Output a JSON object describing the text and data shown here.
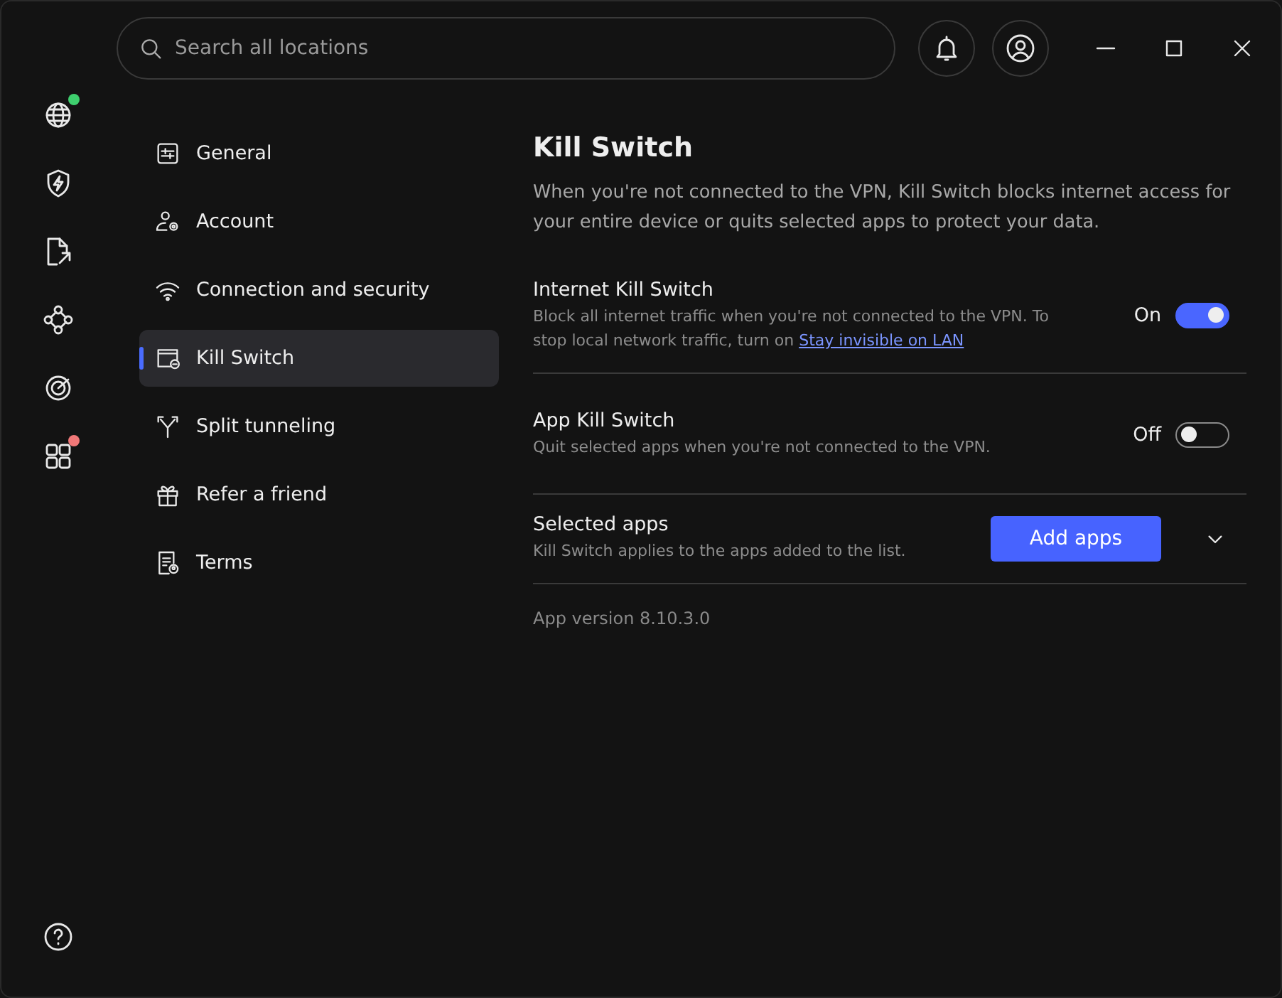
{
  "search": {
    "placeholder": "Search all locations"
  },
  "rail": [
    {
      "kind": "globe",
      "color": "#3ecf6e"
    },
    {
      "kind": "shield"
    },
    {
      "kind": "file"
    },
    {
      "kind": "nodes"
    },
    {
      "kind": "target"
    },
    {
      "kind": "apps",
      "color": "#f07878"
    }
  ],
  "menu": [
    {
      "kind": "sliders",
      "label": "General",
      "selected": false
    },
    {
      "kind": "account",
      "label": "Account",
      "selected": false
    },
    {
      "kind": "wifi",
      "label": "Connection and security",
      "selected": false
    },
    {
      "kind": "killswitch",
      "label": "Kill Switch",
      "selected": true
    },
    {
      "kind": "split",
      "label": "Split tunneling",
      "selected": false
    },
    {
      "kind": "gift",
      "label": "Refer a friend",
      "selected": false
    },
    {
      "kind": "terms",
      "label": "Terms",
      "selected": false
    }
  ],
  "page": {
    "title": "Kill Switch",
    "description": "When you're not connected to the VPN, Kill Switch blocks internet access for your entire device or quits selected apps to protect your data."
  },
  "settings": [
    {
      "kind": "toggle",
      "title": "Internet Kill Switch",
      "description": "Block all internet traffic when you're not connected to the VPN. To stop local network traffic, turn on",
      "link": "Stay invisible on LAN",
      "state_label": "On",
      "on": true
    },
    {
      "kind": "toggle",
      "title": "App Kill Switch",
      "description": "Quit selected apps when you're not connected to the VPN.",
      "state_label": "Off",
      "on": false
    },
    {
      "kind": "apps",
      "title": "Selected apps",
      "description": "Kill Switch applies to the apps added to the list.",
      "button": "Add apps",
      "expanded": false
    }
  ],
  "version": "App version 8.10.3.0"
}
